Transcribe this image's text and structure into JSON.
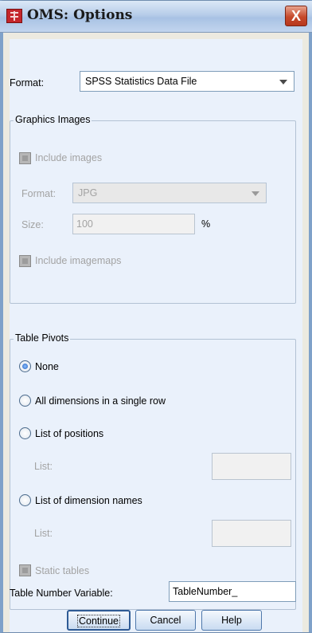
{
  "window": {
    "title": "OMS: Options",
    "close_label": "X"
  },
  "format": {
    "label": "Format:",
    "value": "SPSS Statistics Data File"
  },
  "graphics": {
    "group_title": "Graphics Images",
    "include_images": "Include images",
    "format_label": "Format:",
    "format_value": "JPG",
    "size_label": "Size:",
    "size_value": "100",
    "size_unit": "%",
    "include_imagemaps": "Include imagemaps"
  },
  "pivots": {
    "group_title": "Table Pivots",
    "options": [
      {
        "label": "None",
        "selected": true
      },
      {
        "label": "All dimensions in a single row",
        "selected": false
      },
      {
        "label": "List of positions",
        "selected": false
      },
      {
        "label": "List of dimension names",
        "selected": false
      }
    ],
    "list_label_1": "List:",
    "list_label_2": "List:",
    "static_tables": "Static tables"
  },
  "table_number": {
    "label": "Table Number Variable:",
    "value": "TableNumber_"
  },
  "buttons": {
    "continue": "Continue",
    "cancel": "Cancel",
    "help": "Help"
  },
  "colors": {
    "accent": "#4f78ab",
    "titlebar": "#b7cde9",
    "close": "#c6492b"
  }
}
